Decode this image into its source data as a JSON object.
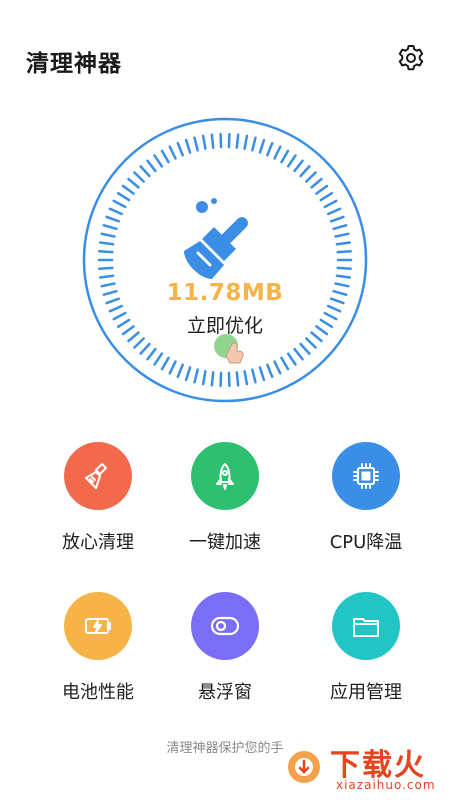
{
  "header": {
    "title": "清理神器",
    "settings_icon": "gear-icon"
  },
  "cleaner": {
    "junk_size": "11.78MB",
    "action_label": "立即优化",
    "icon": "broom-icon",
    "accent": "#3a8ee6",
    "size_color": "#f7b348"
  },
  "features": [
    {
      "label": "放心清理",
      "icon": "broom-icon",
      "color": "#f26a4b"
    },
    {
      "label": "一键加速",
      "icon": "rocket-icon",
      "color": "#2fbf71"
    },
    {
      "label": "CPU降温",
      "icon": "cpu-chip-icon",
      "color": "#3a8ee6"
    },
    {
      "label": "电池性能",
      "icon": "battery-charging-icon",
      "color": "#f7b348"
    },
    {
      "label": "悬浮窗",
      "icon": "toggle-icon",
      "color": "#7b6ef6"
    },
    {
      "label": "应用管理",
      "icon": "folder-icon",
      "color": "#22c4c4"
    }
  ],
  "footer": {
    "text": "清理神器保护您的手"
  },
  "watermark": {
    "text": "下载火",
    "sub": "xiazaihuo.com"
  }
}
